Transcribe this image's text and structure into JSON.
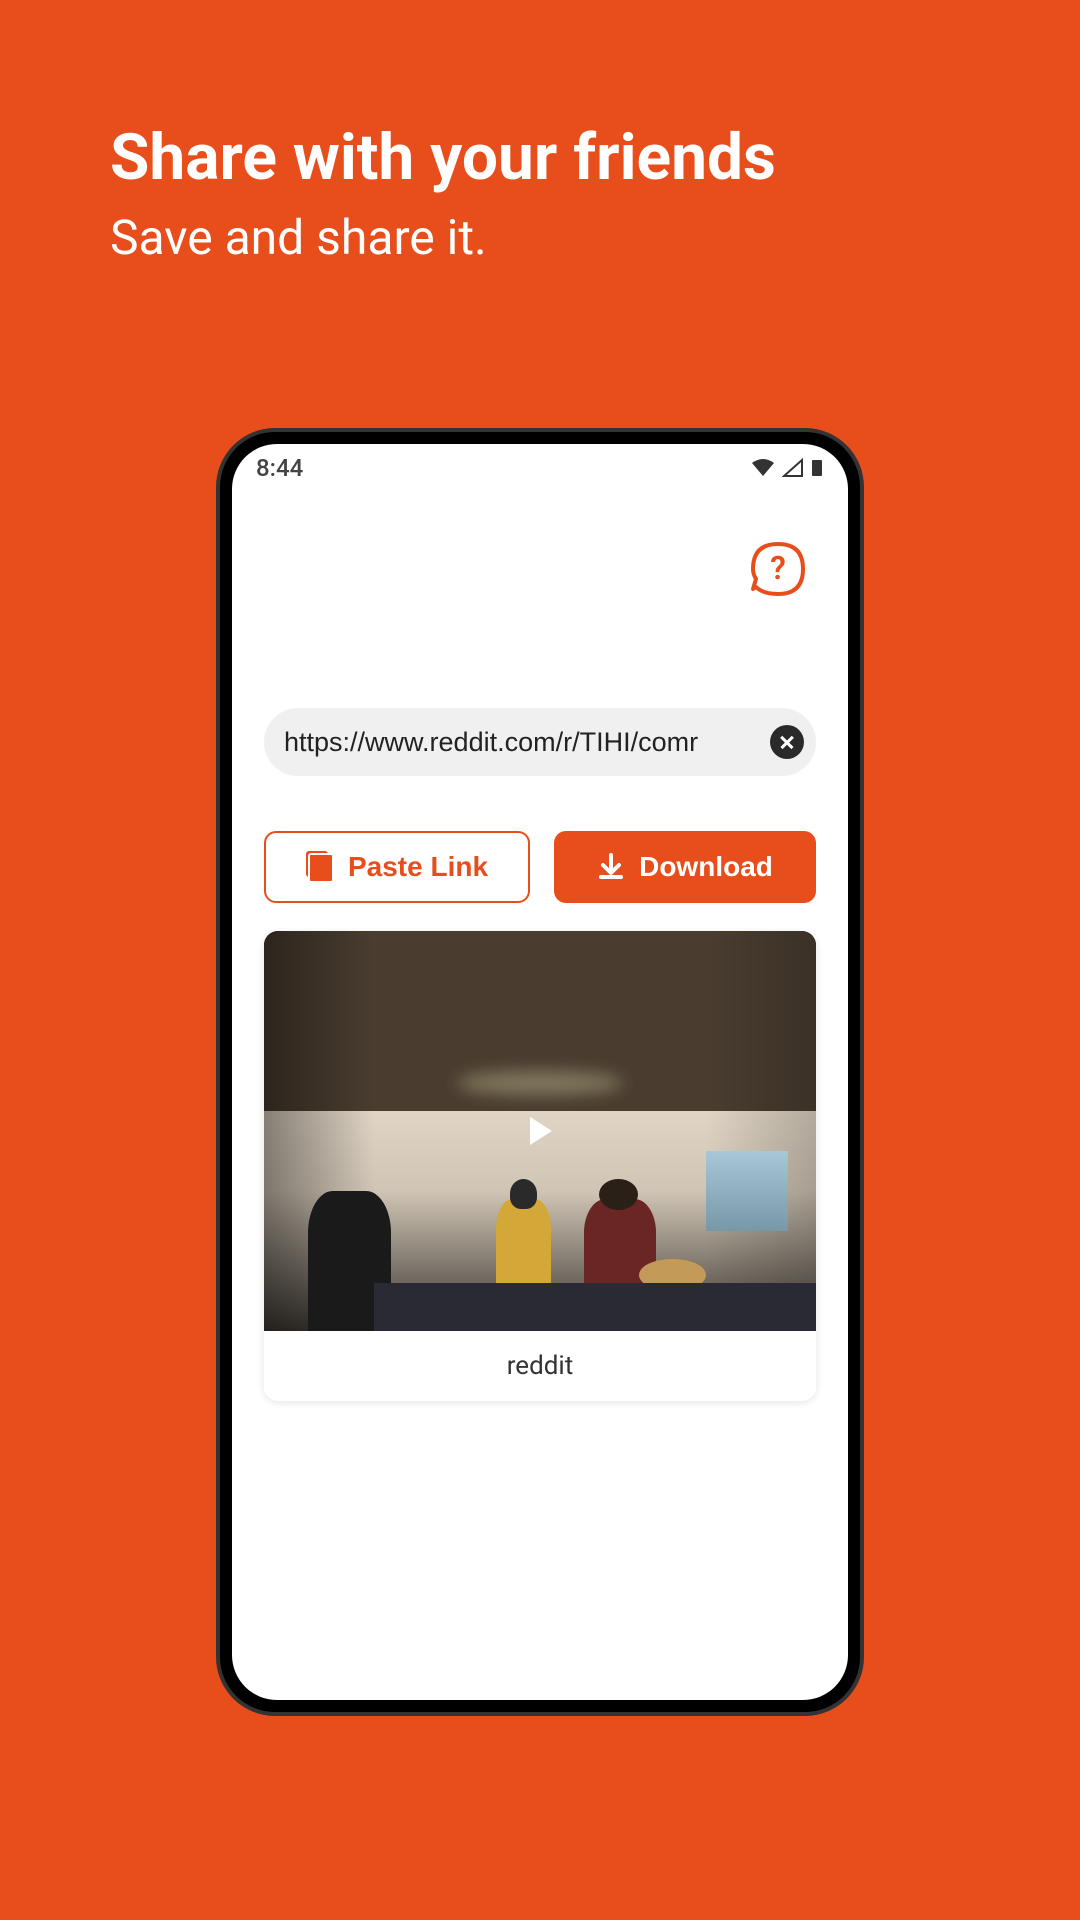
{
  "header": {
    "title": "Share with your friends",
    "subtitle": "Save and share it."
  },
  "statusBar": {
    "time": "8:44"
  },
  "urlInput": {
    "value": "https://www.reddit.com/r/TIHI/comr"
  },
  "buttons": {
    "paste": "Paste Link",
    "download": "Download"
  },
  "video": {
    "source": "reddit"
  }
}
